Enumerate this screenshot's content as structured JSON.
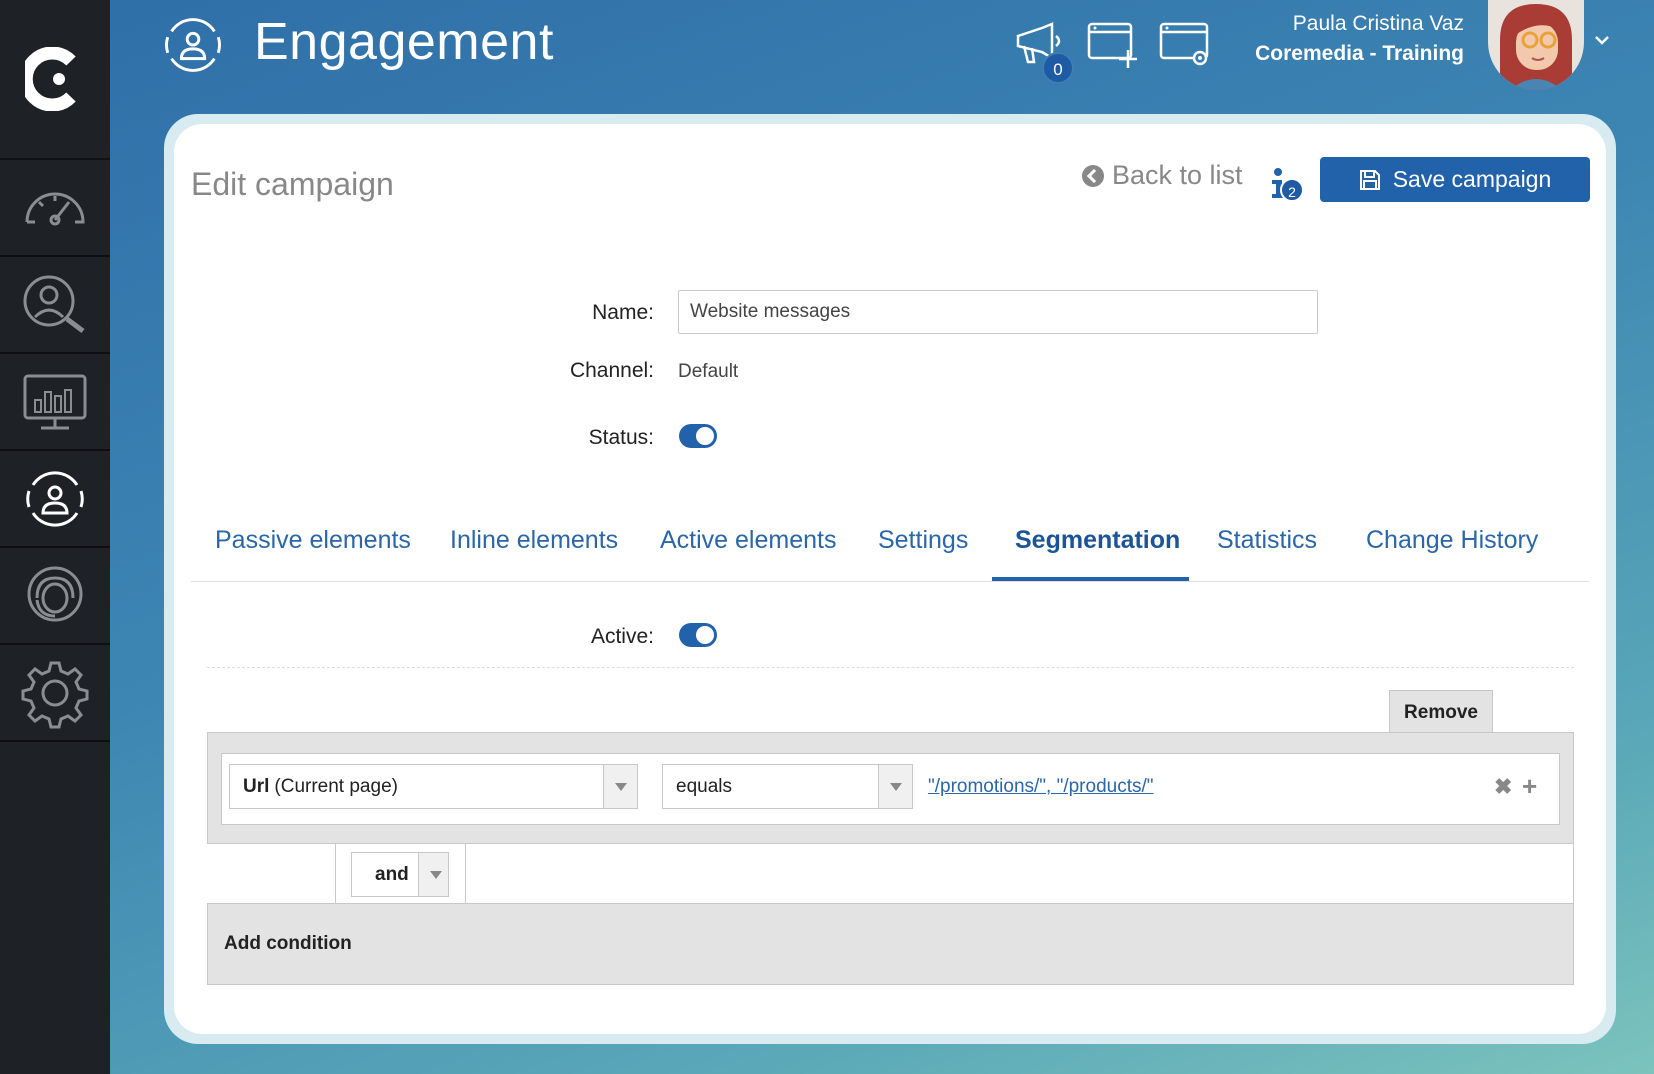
{
  "header": {
    "title": "Engagement",
    "notification_count": "0",
    "user_name": "Paula Cristina Vaz",
    "user_org": "Coremedia - Training"
  },
  "sidebar": {
    "items": [
      {
        "icon": "speedometer-icon"
      },
      {
        "icon": "user-search-icon"
      },
      {
        "icon": "analytics-monitor-icon"
      },
      {
        "icon": "engagement-icon"
      },
      {
        "icon": "support-agent-icon"
      },
      {
        "icon": "gear-icon"
      }
    ]
  },
  "page": {
    "title": "Edit campaign",
    "back_label": "Back to list",
    "info_count": "2",
    "save_label": "Save campaign"
  },
  "form": {
    "name_label": "Name:",
    "name_value": "Website messages",
    "channel_label": "Channel:",
    "channel_value": "Default",
    "status_label": "Status:",
    "status_on": true
  },
  "tabs": [
    {
      "label": "Passive elements"
    },
    {
      "label": "Inline elements"
    },
    {
      "label": "Active elements"
    },
    {
      "label": "Settings"
    },
    {
      "label": "Segmentation",
      "active": true
    },
    {
      "label": "Statistics"
    },
    {
      "label": "Change History"
    }
  ],
  "segmentation": {
    "active_label": "Active:",
    "active_on": true,
    "remove_label": "Remove",
    "condition": {
      "field_bold": "Url",
      "field_rest": "(Current page)",
      "operator": "equals",
      "value": "\"/promotions/\", \"/products/\""
    },
    "connector": "and",
    "add_condition_label": "Add condition"
  },
  "colors": {
    "accent": "#2262ab",
    "sidebar": "#1e2126"
  }
}
